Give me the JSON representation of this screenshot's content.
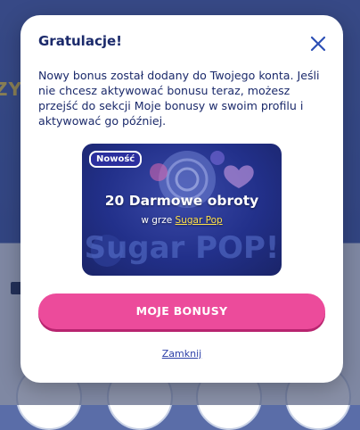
{
  "background": {
    "hero_text": "ZY",
    "colors": {
      "hero_blue": "#3e59ad",
      "page_light": "#e9eef7"
    }
  },
  "modal": {
    "title": "Gratulacje!",
    "close_icon": "close-icon",
    "body_text": "Nowy bonus został dodany do Twojego konta. Jeśli nie chcesz aktywować bonusu teraz, możesz przejść do sekcji Moje bonusy w swoim profilu i aktywować go później.",
    "bonus_card": {
      "badge": "Nowość",
      "title": "20 Darmowe obroty",
      "game_prefix": "w grze",
      "game_name": "Sugar Pop",
      "background_art_text": "Sugar POP!"
    },
    "primary_button_label": "MOJE BONUSY",
    "close_link_label": "Zamknij",
    "colors": {
      "title": "#1b2a6b",
      "primary_button": "#ec4b9b",
      "game_link": "#ffe14a",
      "link": "#2c3fa8"
    }
  }
}
